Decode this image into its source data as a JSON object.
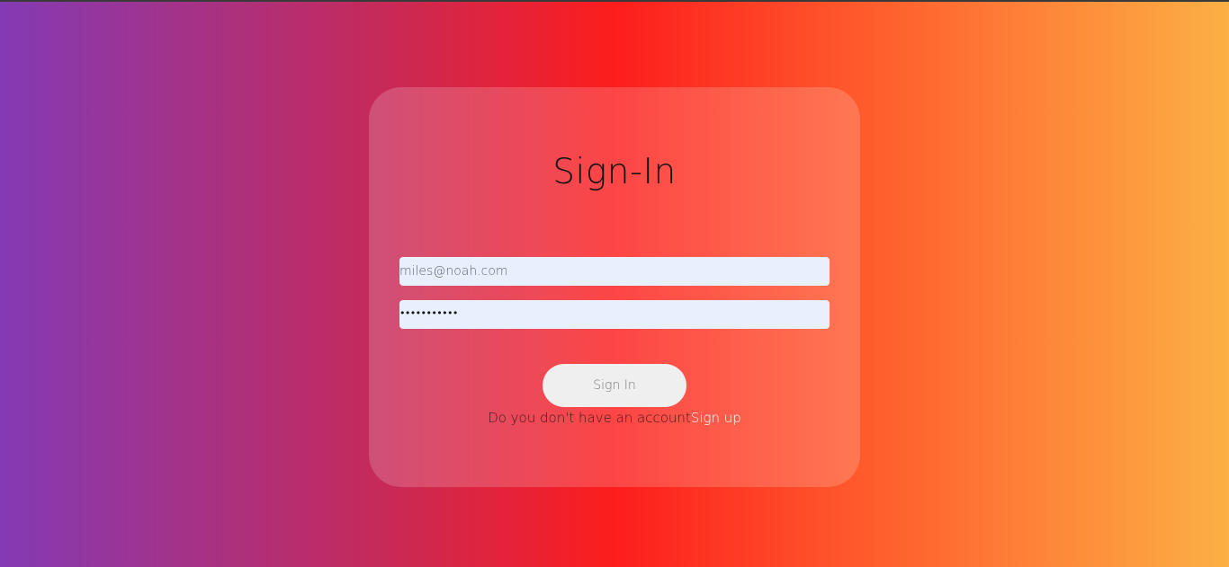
{
  "form": {
    "title": "Sign-In",
    "email_value": "miles@noah.com",
    "password_value": "•••••••••••",
    "submit_label": "Sign In",
    "signup_prompt": "Do you don't have an account",
    "signup_link": "Sign up"
  },
  "colors": {
    "gradient": [
      "#833ab4",
      "#fd1d1d",
      "#fcb045"
    ],
    "card": "rgba(255,255,255,0.18)",
    "input_bg": "#e8f0fe",
    "button_bg": "#efefef"
  }
}
